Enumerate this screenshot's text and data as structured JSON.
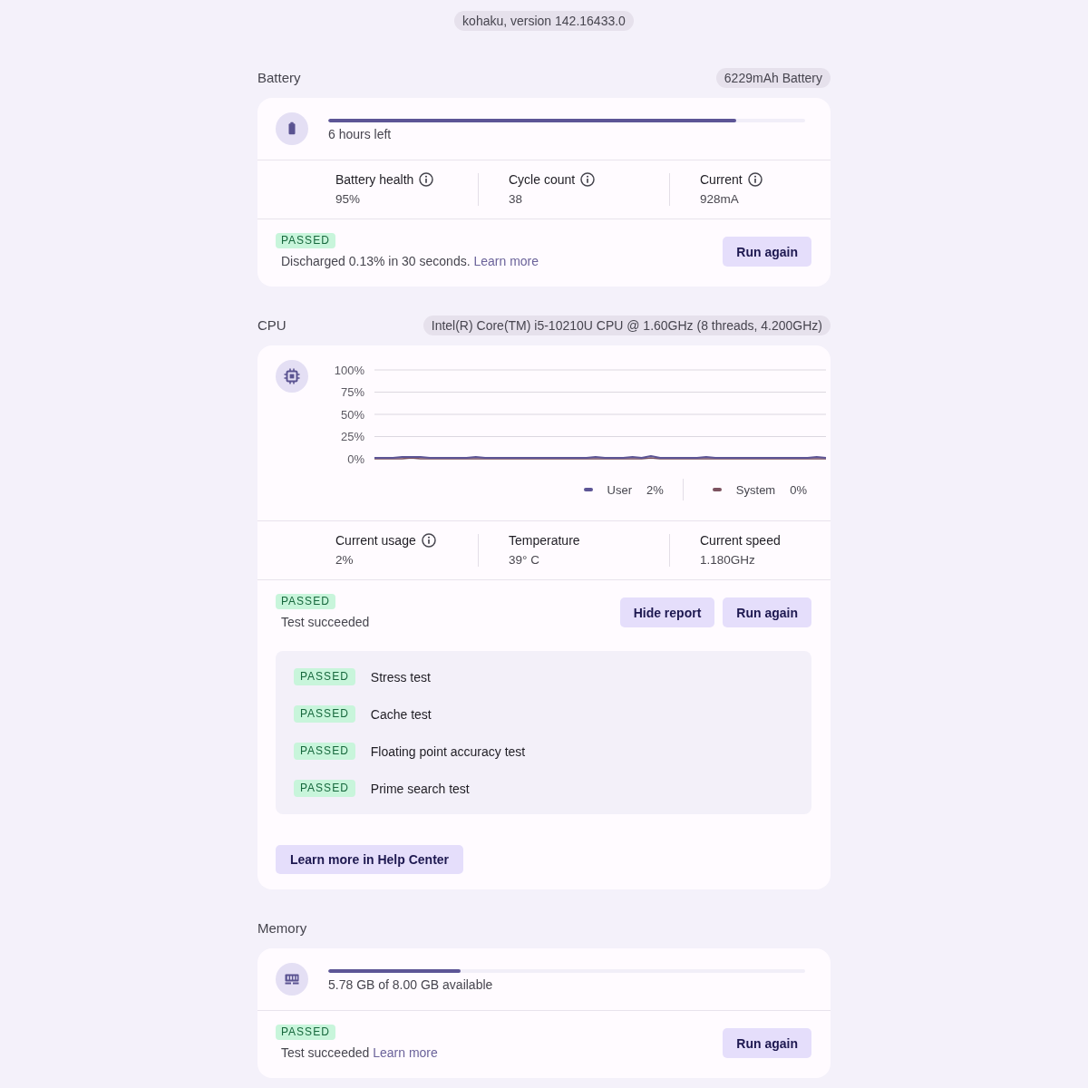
{
  "version": "kohaku, version 142.16433.0",
  "sections": [
    {
      "kind": "battery",
      "title": "Battery",
      "spec": "6229mAh Battery",
      "meter": {
        "level": 0.855,
        "caption": "6 hours left"
      },
      "metrics": [
        {
          "label": "Battery health",
          "value": "95%",
          "info": true
        },
        {
          "label": "Cycle count",
          "value": "38",
          "info": true
        },
        {
          "label": "Current",
          "value": "928mA",
          "info": true
        }
      ],
      "result": {
        "status": {
          "label": "PASSED",
          "kind": "passed"
        },
        "message": "Discharged 0.13% in 30 seconds.",
        "link": "Learn more"
      },
      "buttons": [
        "Run again"
      ]
    },
    {
      "kind": "cpu",
      "title": "CPU",
      "spec": "Intel(R) Core(TM) i5-10210U CPU @ 1.60GHz (8 threads, 4.200GHz)",
      "chart_data": {
        "type": "line",
        "grid": true,
        "ylim": [
          0,
          100
        ],
        "yticks": [
          {
            "value": 100,
            "label": "100%"
          },
          {
            "value": 75,
            "label": "75%"
          },
          {
            "value": 50,
            "label": "50%"
          },
          {
            "value": 25,
            "label": "25%"
          },
          {
            "value": 0,
            "label": "0%"
          }
        ],
        "series": [
          {
            "name": "User",
            "color": "#5d5596",
            "values": [
              1,
              1,
              1,
              2,
              2,
              2,
              1,
              1,
              1,
              1,
              1,
              2,
              1,
              1,
              1,
              1,
              1,
              1,
              1,
              1,
              1,
              1,
              1,
              1,
              2,
              1,
              1,
              1,
              2,
              1,
              3,
              1,
              1,
              1,
              1,
              1,
              2,
              1,
              1,
              1,
              1,
              1,
              1,
              1,
              1,
              1,
              1,
              1,
              2,
              1
            ]
          },
          {
            "name": "System",
            "color": "#7d5260",
            "values": [
              0,
              0,
              0,
              0,
              1,
              0,
              0,
              0,
              0,
              0,
              0,
              0,
              0,
              0,
              0,
              0,
              0,
              0,
              0,
              0,
              0,
              0,
              0,
              0,
              0,
              0,
              0,
              0,
              0,
              0,
              1,
              0,
              0,
              0,
              0,
              0,
              0,
              0,
              0,
              0,
              0,
              0,
              0,
              0,
              0,
              0,
              0,
              0,
              0,
              0
            ]
          }
        ]
      },
      "legend_readings": [
        "2%",
        "0%"
      ],
      "metrics": [
        {
          "label": "Current usage",
          "value": "2%",
          "info": true
        },
        {
          "label": "Temperature",
          "value": "39° C",
          "info": false
        },
        {
          "label": "Current speed",
          "value": "1.180GHz",
          "info": false
        }
      ],
      "result": {
        "status": {
          "label": "PASSED",
          "kind": "passed"
        },
        "message": "Test succeeded"
      },
      "buttons": [
        "Hide report",
        "Run again"
      ],
      "report": [
        {
          "status": {
            "label": "PASSED",
            "kind": "passed"
          },
          "name": "Stress test"
        },
        {
          "status": {
            "label": "PASSED",
            "kind": "passed"
          },
          "name": "Cache test"
        },
        {
          "status": {
            "label": "PASSED",
            "kind": "passed"
          },
          "name": "Floating point accuracy test"
        },
        {
          "status": {
            "label": "PASSED",
            "kind": "passed"
          },
          "name": "Prime search test"
        }
      ],
      "help_button": "Learn more in Help Center"
    },
    {
      "kind": "memory",
      "title": "Memory",
      "meter": {
        "level": 0.278,
        "caption": "5.78 GB of 8.00 GB available"
      },
      "result": {
        "status": {
          "label": "PASSED",
          "kind": "passed"
        },
        "message": "Test succeeded",
        "link": "Learn more"
      },
      "buttons": [
        "Run again"
      ]
    }
  ]
}
